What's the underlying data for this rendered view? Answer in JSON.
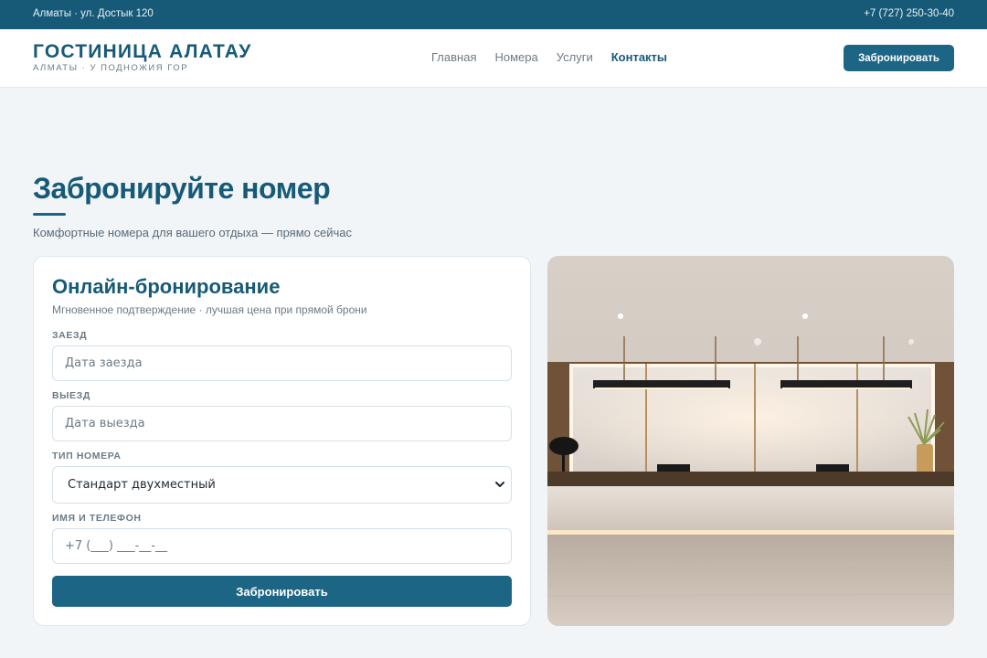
{
  "topbar": {
    "address": "Алматы · ул. Достык 120",
    "phone": "+7 (727) 250-30-40"
  },
  "brand": {
    "title": "ГОСТИНИЦА АЛАТАУ",
    "subtitle": "АЛМАТЫ · У ПОДНОЖИЯ ГОР"
  },
  "nav": {
    "items": [
      "Главная",
      "Номера",
      "Услуги",
      "Контакты"
    ],
    "active": "Контакты"
  },
  "header_button": "Забронировать",
  "hero": {
    "title": "Забронируйте номер",
    "subtitle": "Комфортные номера для вашего отдыха — прямо сейчас"
  },
  "form": {
    "title": "Онлайн-бронирование",
    "subtitle": "Мгновенное подтверждение · лучшая цена при прямой брони",
    "checkin": {
      "label": "ЗАЕЗД",
      "placeholder": "Дата заезда"
    },
    "checkout": {
      "label": "ВЫЕЗД",
      "placeholder": "Дата выезда"
    },
    "room": {
      "label": "ТИП НОМЕРА",
      "selected": "Стандарт двухместный"
    },
    "contact": {
      "label": "ИМЯ И ТЕЛЕФОН",
      "placeholder": "+7 (___) ___-__-__"
    },
    "submit": "Забронировать"
  },
  "photo": {
    "icon": "hotel-reception-photo"
  },
  "colors": {
    "primary": "#175a78",
    "button": "#1d6585",
    "background": "#f1f5f8"
  }
}
